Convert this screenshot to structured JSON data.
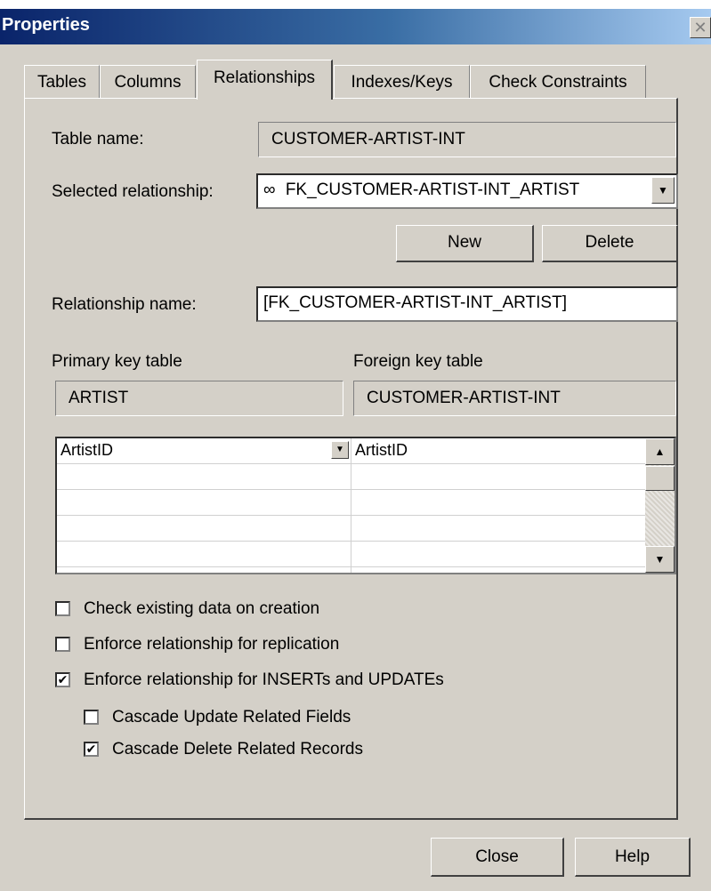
{
  "window": {
    "title": "Properties",
    "close_glyph": "✕"
  },
  "tabs": [
    "Tables",
    "Columns",
    "Relationships",
    "Indexes/Keys",
    "Check Constraints"
  ],
  "active_tab": "Relationships",
  "form": {
    "table_name_label": "Table name:",
    "table_name_value": "CUSTOMER-ARTIST-INT",
    "selected_relationship_label": "Selected relationship:",
    "selected_relationship_icon": "∞",
    "selected_relationship_value": "FK_CUSTOMER-ARTIST-INT_ARTIST",
    "new_button": "New",
    "delete_button": "Delete",
    "relationship_name_label": "Relationship name:",
    "relationship_name_value": "[FK_CUSTOMER-ARTIST-INT_ARTIST]",
    "primary_key_table_label": "Primary key table",
    "primary_key_table_value": "ARTIST",
    "foreign_key_table_label": "Foreign key table",
    "foreign_key_table_value": "CUSTOMER-ARTIST-INT"
  },
  "column_grid": {
    "rows": [
      {
        "primary": "ArtistID",
        "foreign": "ArtistID"
      },
      {
        "primary": "",
        "foreign": ""
      },
      {
        "primary": "",
        "foreign": ""
      },
      {
        "primary": "",
        "foreign": ""
      },
      {
        "primary": "",
        "foreign": ""
      }
    ]
  },
  "options": [
    {
      "label": "Check existing data on creation",
      "checked": false
    },
    {
      "label": "Enforce relationship for replication",
      "checked": false
    },
    {
      "label": "Enforce relationship for INSERTs and UPDATEs",
      "checked": true
    },
    {
      "label": "Cascade Update Related Fields",
      "checked": false
    },
    {
      "label": "Cascade Delete Related Records",
      "checked": true
    }
  ],
  "footer": {
    "close_button": "Close",
    "help_button": "Help"
  },
  "colors": {
    "title_bar_start": "#0a246a",
    "title_bar_end": "#a6caf0",
    "dialog_face": "#d4d0c8"
  }
}
